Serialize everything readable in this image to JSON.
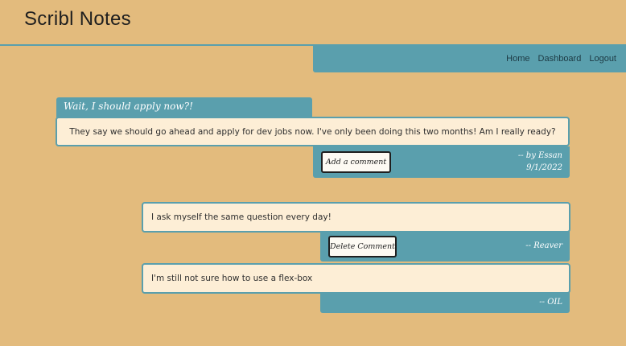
{
  "app": {
    "title": "Scribl Notes"
  },
  "nav": {
    "links": [
      "Home",
      "Dashboard",
      "Logout"
    ]
  },
  "post": {
    "title": "Wait, I should apply now?!",
    "body": "They say we should go ahead and apply for dev jobs now. I've only been doing this two months! Am I really ready?",
    "add_comment_label": "Add a comment",
    "author_line": "-- by Essan",
    "date": "9/1/2022"
  },
  "comments": [
    {
      "text": "I ask myself the same question every day!",
      "delete_label": "Delete Comment",
      "author": "-- Reaver"
    },
    {
      "text": "I'm still not sure how to use a flex-box",
      "author": "-- OIL"
    }
  ],
  "colors": {
    "background": "#e3bb7d",
    "accent": "#5a9fad",
    "card": "#fdeed6"
  }
}
